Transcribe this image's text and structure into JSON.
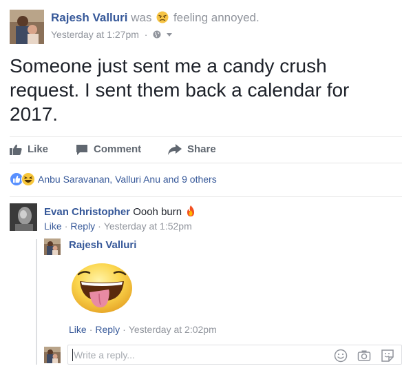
{
  "post": {
    "author": "Rajesh Valluri",
    "was": "was",
    "feeling": "feeling annoyed.",
    "feeling_icon": "annoyed-face-icon",
    "timestamp": "Yesterday at 1:27pm",
    "dot": "·",
    "privacy_icon": "globe-icon",
    "text": "Someone just sent me a candy crush request. I sent them back a calendar for 2017."
  },
  "actions": {
    "like": "Like",
    "comment": "Comment",
    "share": "Share"
  },
  "reactions": {
    "icons": [
      "like-reaction-icon",
      "haha-reaction-icon"
    ],
    "summary": "Anbu Saravanan, Valluri Anu and 9 others"
  },
  "comments": [
    {
      "author": "Evan Christopher",
      "text": "Oooh burn",
      "emoji_icon": "fire-icon",
      "like": "Like",
      "reply": "Reply",
      "sep": "·",
      "timestamp": "Yesterday at 1:52pm"
    }
  ],
  "reply": {
    "author": "Rajesh Valluri",
    "sticker_icon": "tongue-out-sticker",
    "like": "Like",
    "reply": "Reply",
    "sep": "·",
    "timestamp": "Yesterday at 2:02pm"
  },
  "composer": {
    "placeholder": "Write a reply...",
    "icons": [
      "emoji-icon",
      "camera-icon",
      "sticker-icon"
    ]
  },
  "colors": {
    "link": "#365899",
    "meta": "#90949c",
    "text": "#1d2129",
    "action": "#606770",
    "like_blue": "#5890ff",
    "haha_yellow": "#f7c63b"
  }
}
